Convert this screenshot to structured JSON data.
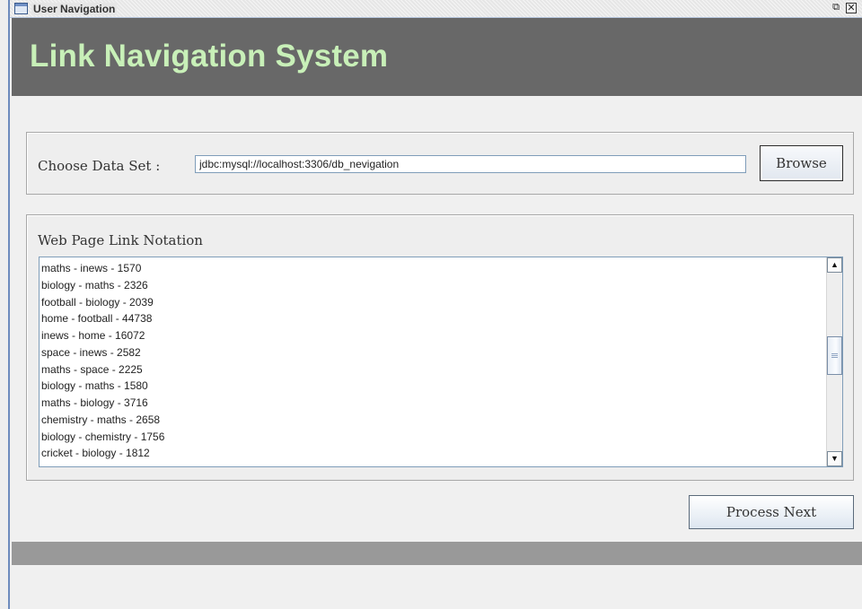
{
  "window": {
    "title": "User Navigation",
    "restore_symbol": "⧉",
    "close_symbol": "✕"
  },
  "header": {
    "title": "Link Navigation System",
    "title_color": "#c8f0b8",
    "band_color": "#686868"
  },
  "dataset": {
    "label": "Choose Data Set :",
    "input_value": "jdbc:mysql://localhost:3306/db_nevigation",
    "browse_label": "Browse"
  },
  "links": {
    "label": "Web Page Link Notation",
    "items": [
      "maths - inews - 1570",
      "biology - maths - 2326",
      "football - biology - 2039",
      "home - football - 44738",
      "inews - home - 16072",
      "space - inews - 2582",
      "maths - space - 2225",
      "biology - maths - 1580",
      "maths - biology - 3716",
      "chemistry - maths - 2658",
      "biology - chemistry - 1756",
      "cricket - biology - 1812"
    ],
    "scroll_up_symbol": "▲",
    "scroll_down_symbol": "▼"
  },
  "actions": {
    "process_label": "Process Next"
  },
  "icons": [
    "window-icon",
    "restore-icon",
    "close-icon",
    "scroll-up-icon",
    "scroll-down-icon"
  ]
}
